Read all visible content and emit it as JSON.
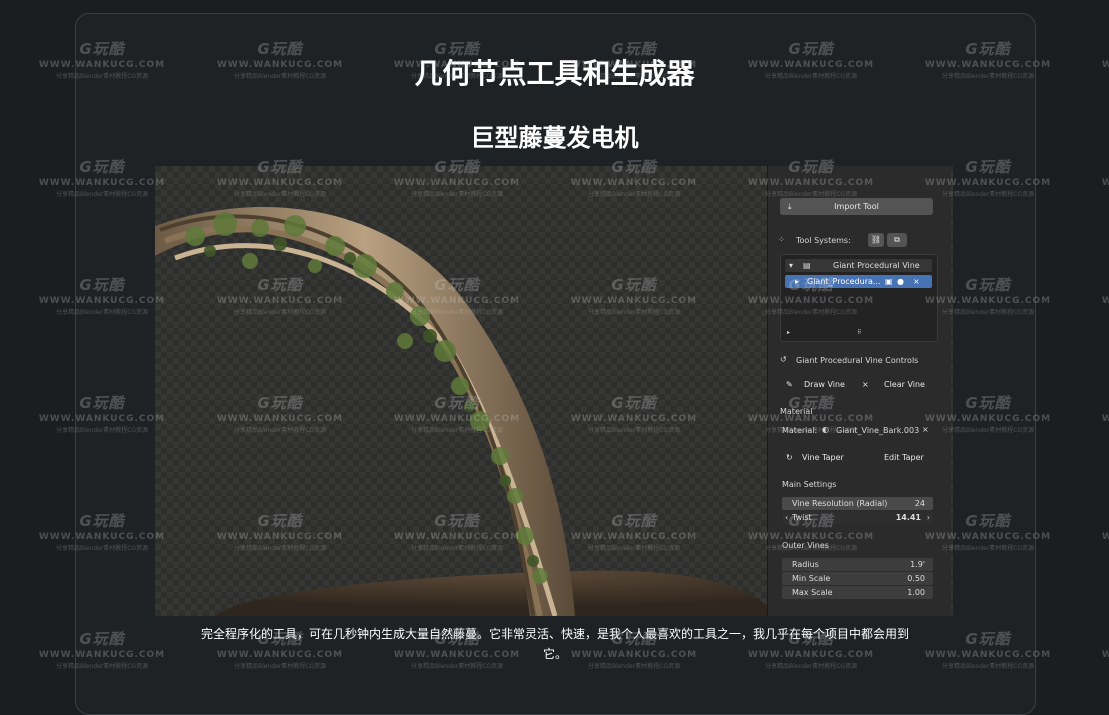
{
  "page": {
    "title": "几何节点工具和生成器",
    "subtitle": "巨型藤蔓发电机",
    "caption": "完全程序化的工具，可在几秒钟内生成大量自然藤蔓。它非常灵活、快速，是我个人最喜欢的工具之一，我几乎在每个项目中都会用到它。"
  },
  "watermark": {
    "logo": "G玩酷",
    "site": "WWW.WANKUCG.COM",
    "tagline": "分享精品Blender素材教程CG资源"
  },
  "panel": {
    "import_tool_label": "Import Tool",
    "tool_systems_label": "Tool Systems:",
    "tree_parent_label": "Giant Procedural Vine",
    "tree_child_label": "Giant_Procedura...",
    "controls_title": "Giant Procedural Vine Controls",
    "draw_vine_label": "Draw Vine",
    "clear_vine_label": "Clear Vine",
    "material_section": "Material",
    "material_label": "Material:",
    "material_value": "Giant_Vine_Bark.003",
    "vine_taper_label": "Vine Taper",
    "edit_taper_label": "Edit Taper",
    "main_settings_title": "Main Settings",
    "vine_resolution_label": "Vine Resolution (Radial)",
    "vine_resolution_value": "24",
    "twist_label": "Twist",
    "twist_value": "14.41",
    "outer_vines_title": "Outer Vines",
    "radius_label": "Radius",
    "radius_value": "1.9'",
    "min_scale_label": "Min Scale",
    "min_scale_value": "0.50",
    "max_scale_label": "Max Scale",
    "max_scale_value": "1.00"
  },
  "colors": {
    "background": "#1b1e21",
    "panel": "#2b2b2b",
    "selection": "#4772b3"
  }
}
